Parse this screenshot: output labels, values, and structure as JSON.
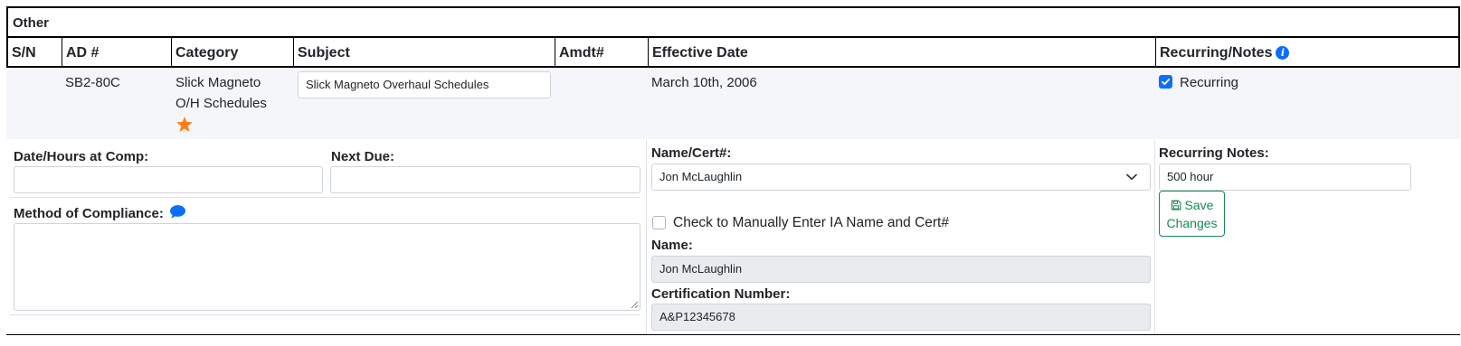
{
  "section": {
    "title": "Other"
  },
  "columns": {
    "sn": "S/N",
    "ad": "AD #",
    "category": "Category",
    "subject": "Subject",
    "amdt": "Amdt#",
    "effective_date": "Effective Date",
    "recurring_notes": "Recurring/Notes"
  },
  "row": {
    "sn": "",
    "ad": "SB2-80C",
    "category_line1": "Slick Magneto",
    "category_line2": "O/H Schedules",
    "subject_value": "Slick Magneto Overhaul Schedules",
    "amdt": "",
    "effective_date": "March 10th, 2006",
    "recurring_checked": true,
    "recurring_label": "Recurring"
  },
  "details": {
    "date_hours_label": "Date/Hours at Comp:",
    "date_hours_value": "",
    "next_due_label": "Next Due:",
    "next_due_value": "",
    "method_label": "Method of Compliance:",
    "method_value": "",
    "name_cert_label": "Name/Cert#:",
    "name_cert_selected": "Jon McLaughlin",
    "manual_checkbox_label": "Check to Manually Enter IA Name and Cert#",
    "manual_checked": false,
    "name_label": "Name:",
    "name_value": "Jon McLaughlin",
    "cert_label": "Certification Number:",
    "cert_value": "A&P12345678",
    "recurring_notes_label": "Recurring Notes:",
    "recurring_notes_value": "500 hour",
    "save_label_line1": "Save",
    "save_label_line2": "Changes"
  },
  "colors": {
    "accent": "#0d6efd",
    "star": "#fd7e14",
    "success": "#198754",
    "row_bg": "#f4f6f9",
    "disabled_bg": "#e9ecef"
  },
  "icons": {
    "info": "info-circle-icon",
    "star": "star-icon",
    "comment": "chat-bubble-icon",
    "chevron": "chevron-down-icon",
    "save": "floppy-disk-icon",
    "check": "check-icon"
  }
}
